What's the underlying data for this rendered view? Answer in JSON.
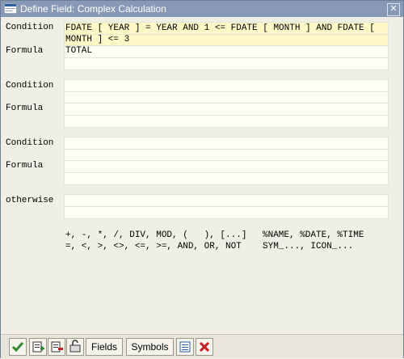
{
  "window": {
    "title": "Define Field: Complex Calculation"
  },
  "labels": {
    "condition": "Condition",
    "formula": "Formula",
    "otherwise": "otherwise"
  },
  "blocks": [
    {
      "condition_line1": "FDATE [ YEAR ] = YEAR AND 1 <= FDATE [ MONTH ] AND FDATE [",
      "condition_line2": "MONTH ] <= 3",
      "formula": "TOTAL"
    },
    {
      "condition_line1": "",
      "condition_line2": "",
      "formula": ""
    },
    {
      "condition_line1": "",
      "condition_line2": "",
      "formula": ""
    }
  ],
  "otherwise_value": "",
  "help": {
    "line1_ops": "+, -, *, /, DIV, MOD, (   ), [...]",
    "line1_vars": "%NAME, %DATE, %TIME",
    "line2_ops": "=, <, >, <>, <=, >=, AND, OR, NOT",
    "line2_vars": "SYM_..., ICON_..."
  },
  "toolbar": {
    "fields_label": "Fields",
    "symbols_label": "Symbols"
  }
}
